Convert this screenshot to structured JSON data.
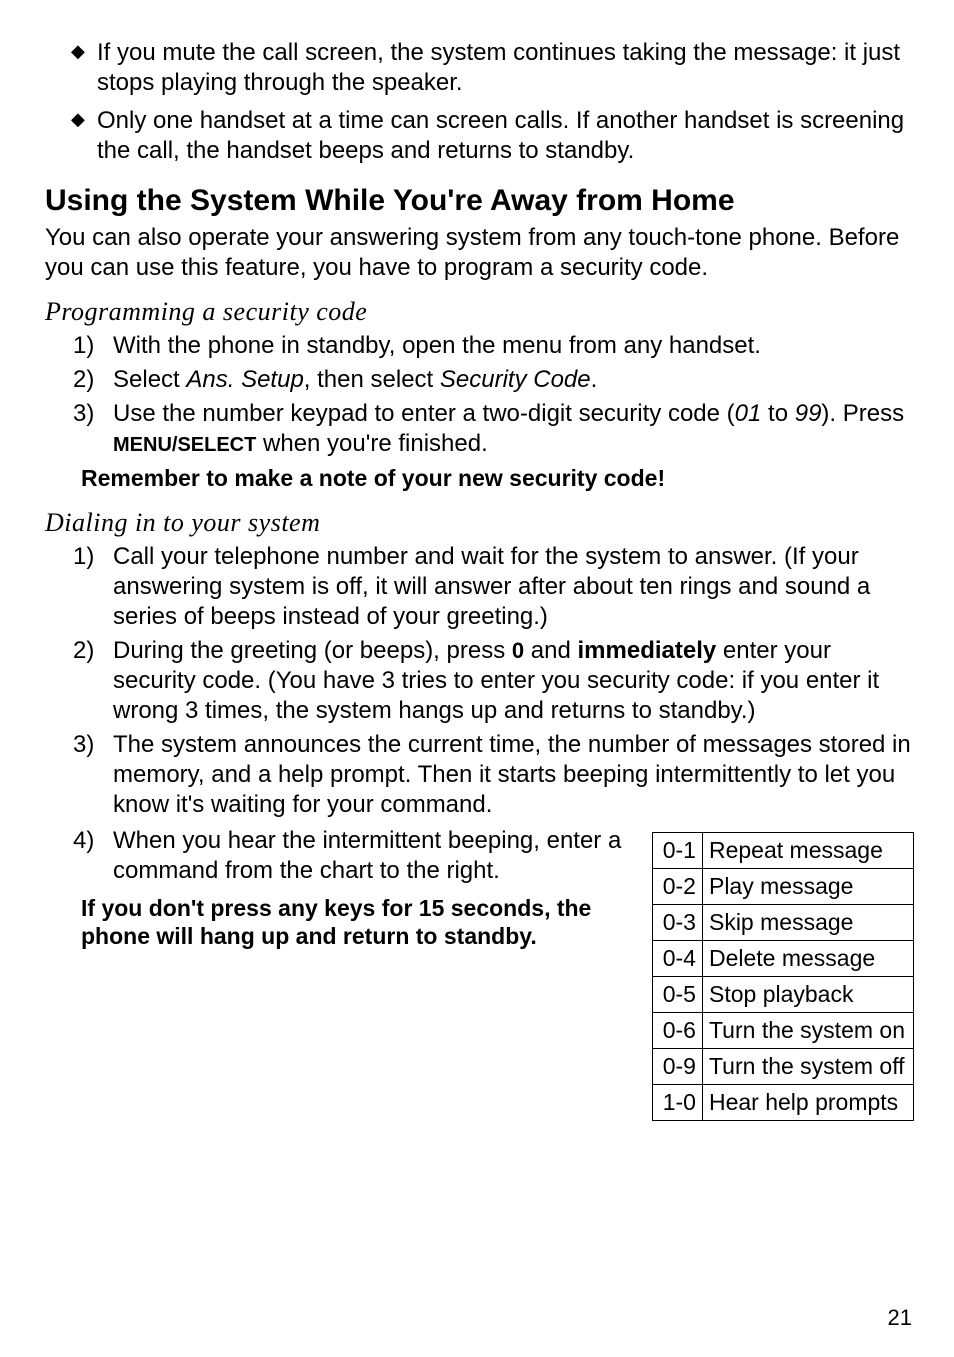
{
  "bullets": [
    "If you mute the call screen, the system continues taking the message: it just stops playing through the speaker.",
    "Only one handset at a time can screen calls. If another handset is screening the call, the handset beeps and returns to standby."
  ],
  "heading1": "Using the System While You're Away from Home",
  "intro": "You can also operate your answering system from any touch-tone phone. Before you can use this feature, you have to program a security code.",
  "section1": {
    "title": "Programming a security code",
    "steps": {
      "s1": "With the phone in standby, open the menu from any handset.",
      "s2_pre": "Select ",
      "s2_em1": "Ans. Setup",
      "s2_mid": ", then select ",
      "s2_em2": "Security Code",
      "s2_post": ".",
      "s3_pre": "Use the number keypad to enter a two-digit security code (",
      "s3_em1": "01",
      "s3_mid": " to ",
      "s3_em2": "99",
      "s3_mid2": "). Press ",
      "s3_key": "MENU/SELECT",
      "s3_post": " when you're finished."
    },
    "note": "Remember to make a note of your new security code!"
  },
  "section2": {
    "title": "Dialing in to your system",
    "steps": {
      "s1": "Call your telephone number and wait for the system to answer. (If your answering system is off, it will answer after about ten rings and sound a series of beeps instead of your greeting.)",
      "s2_pre": "During the greeting (or beeps), press ",
      "s2_key": "0",
      "s2_mid": " and ",
      "s2_bold": "immediately",
      "s2_post": " enter your security code. (You have 3 tries to enter you security code: if you enter it wrong 3 times, the system hangs up and returns to standby.)",
      "s3": "The system announces the current time, the number of messages stored in memory, and a help prompt. Then it starts beeping intermittently to let you know it's waiting for your command.",
      "s4": "When you hear the intermittent beeping, enter a command from the chart to the right."
    },
    "warning": "If you don't press any keys for 15 seconds, the phone will hang up and return to standby."
  },
  "commands": [
    {
      "code": "0-1",
      "desc": "Repeat message"
    },
    {
      "code": "0-2",
      "desc": "Play message"
    },
    {
      "code": "0-3",
      "desc": "Skip message"
    },
    {
      "code": "0-4",
      "desc": "Delete message"
    },
    {
      "code": "0-5",
      "desc": "Stop playback"
    },
    {
      "code": "0-6",
      "desc": "Turn the system on"
    },
    {
      "code": "0-9",
      "desc": "Turn the system off"
    },
    {
      "code": "1-0",
      "desc": "Hear help prompts"
    }
  ],
  "pageNumber": "21"
}
